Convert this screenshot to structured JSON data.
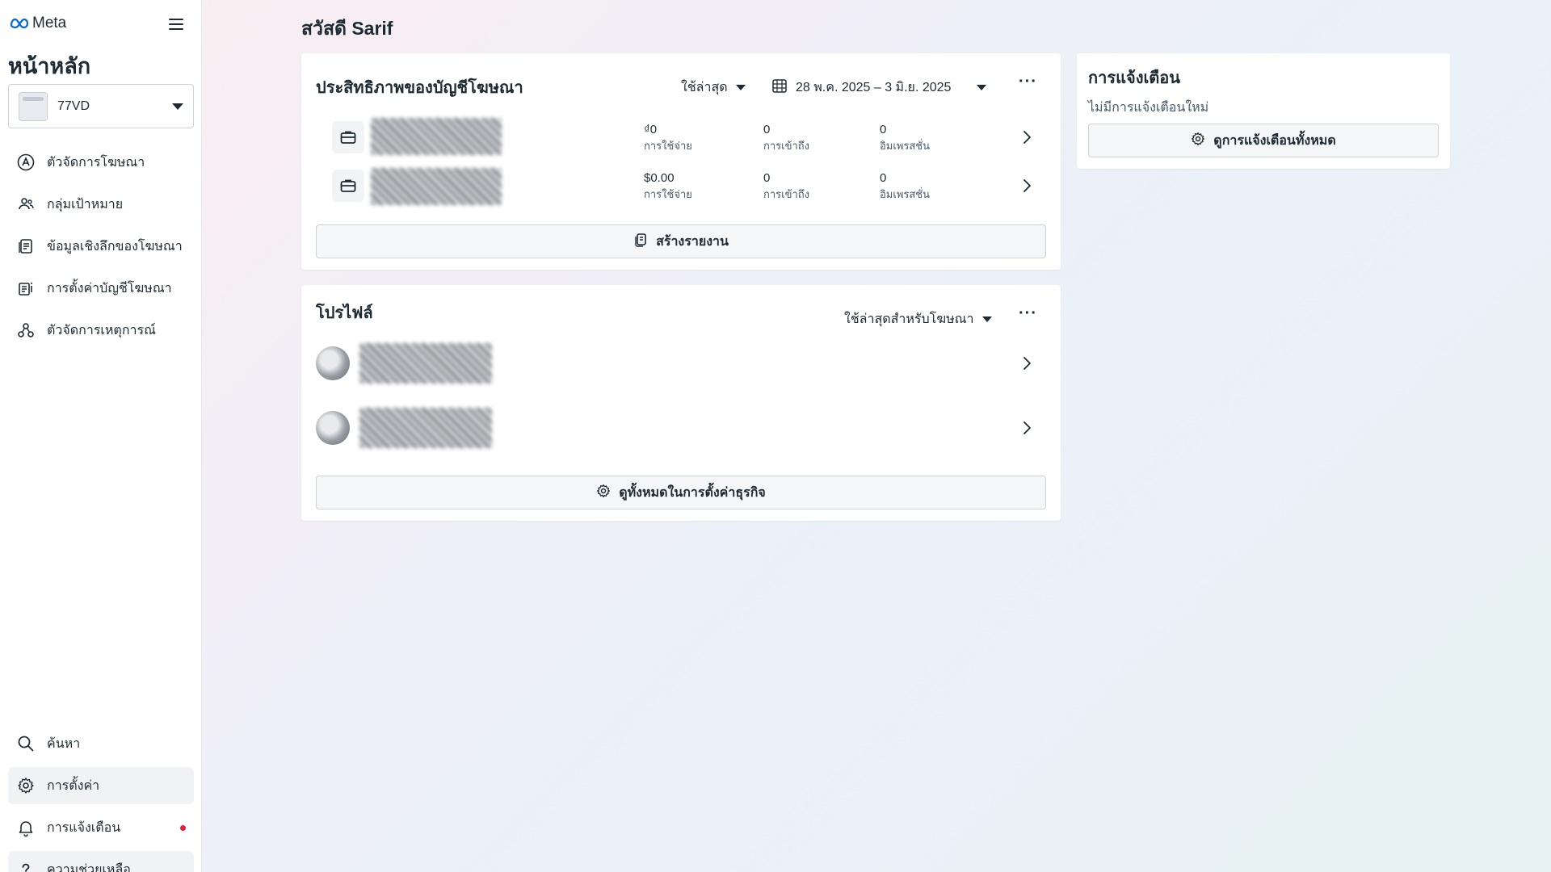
{
  "sidebar": {
    "logo": "Meta",
    "heading": "หน้าหลัก",
    "account": "77VD",
    "nav": [
      {
        "label": "ตัวจัดการโฆษณา",
        "icon": "ads-manager-icon"
      },
      {
        "label": "กลุ่มเป้าหมาย",
        "icon": "audiences-icon"
      },
      {
        "label": "ข้อมูลเชิงลึกของโฆษณา",
        "icon": "insights-icon"
      },
      {
        "label": "การตั้งค่าบัญชีโฆษณา",
        "icon": "account-settings-icon"
      },
      {
        "label": "ตัวจัดการเหตุการณ์",
        "icon": "events-manager-icon"
      }
    ],
    "bottom": [
      {
        "label": "ค้นหา",
        "icon": "search-icon"
      },
      {
        "label": "การตั้งค่า",
        "icon": "gear-icon"
      },
      {
        "label": "การแจ้งเตือน",
        "icon": "bell-icon"
      },
      {
        "label": "ความช่วยเหลือ",
        "icon": "help-icon"
      }
    ]
  },
  "greeting": "สวัสดี Sarif",
  "performance": {
    "title": "ประสิทธิภาพของบัญชีโฆษณา",
    "recent": "ใช้ล่าสุด",
    "date_range": "28 พ.ค. 2025 – 3 มิ.ย. 2025",
    "more": "···",
    "rows": [
      {
        "spend": "₫0",
        "spend_label": "การใช้จ่าย",
        "reach": "0",
        "reach_label": "การเข้าถึง",
        "impressions": "0",
        "impressions_label": "อิมเพรสชั่น"
      },
      {
        "spend": "$0.00",
        "spend_label": "การใช้จ่าย",
        "reach": "0",
        "reach_label": "การเข้าถึง",
        "impressions": "0",
        "impressions_label": "อิมเพรสชั่น"
      }
    ],
    "create_report": "สร้างรายงาน"
  },
  "profiles": {
    "title": "โปรไฟล์",
    "recent": "ใช้ล่าสุดสำหรับโฆษณา",
    "more": "···",
    "view_all": "ดูทั้งหมดในการตั้งค่าธุรกิจ"
  },
  "notifications": {
    "title": "การแจ้งเตือน",
    "empty": "ไม่มีการแจ้งเตือนใหม่",
    "view_all": "ดูการแจ้งเตือนทั้งหมด"
  },
  "colors": {
    "notification_dot": "#e41e3f",
    "meta_blue": "#0668e1"
  }
}
